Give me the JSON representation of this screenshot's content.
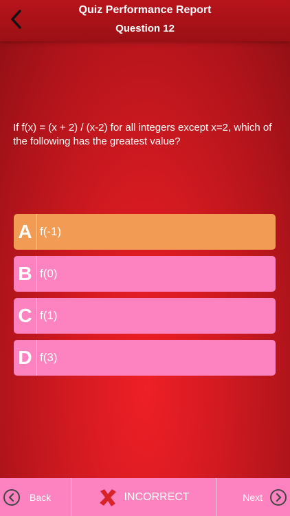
{
  "header": {
    "title": "Quiz Performance Report",
    "subtitle": "Question 12"
  },
  "question": {
    "text": "If f(x) = (x + 2) / (x-2) for all integers except x=2, which of the following has the greatest value?"
  },
  "answers": [
    {
      "letter": "A",
      "text": "f(-1)",
      "selected": true
    },
    {
      "letter": "B",
      "text": "f(0)",
      "selected": false
    },
    {
      "letter": "C",
      "text": "f(1)",
      "selected": false
    },
    {
      "letter": "D",
      "text": "f(3)",
      "selected": false
    }
  ],
  "footer": {
    "back_label": "Back",
    "status_label": "INCORRECT",
    "next_label": "Next"
  },
  "colors": {
    "selected_answer": "#f19b55",
    "answer": "#fc83bf",
    "footer": "#fc83bf",
    "incorrect_mark": "#d8232a"
  },
  "icons": {
    "back": "chevron-left-icon",
    "footer_back": "circle-chevron-left-icon",
    "status": "x-mark-icon",
    "footer_next": "circle-chevron-right-icon"
  }
}
